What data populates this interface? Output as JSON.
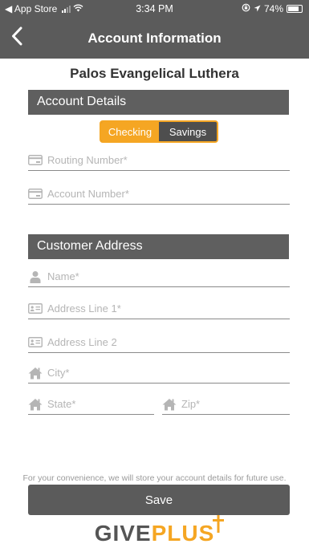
{
  "status_bar": {
    "back_app": "◀ App Store",
    "time": "3:34 PM",
    "battery": "74%"
  },
  "nav": {
    "title": "Account Information"
  },
  "organization": "Palos Evangelical Luthera",
  "account_details": {
    "header": "Account Details",
    "account_type": {
      "options": [
        "Checking",
        "Savings"
      ],
      "selected": "Checking"
    },
    "routing_placeholder": "Routing Number*",
    "account_placeholder": "Account Number*"
  },
  "customer_address": {
    "header": "Customer Address",
    "name_placeholder": "Name*",
    "address1_placeholder": "Address Line 1*",
    "address2_placeholder": "Address Line 2",
    "city_placeholder": "City*",
    "state_placeholder": "State*",
    "zip_placeholder": "Zip*"
  },
  "footer": {
    "note": "For your convenience, we will store your account details for future use.",
    "save_label": "Save"
  },
  "logo": {
    "give": "GIVE",
    "plus": "PLUS"
  },
  "colors": {
    "bar": "#5b5b5b",
    "accent": "#f5a623",
    "icon": "#b5b5b5"
  }
}
